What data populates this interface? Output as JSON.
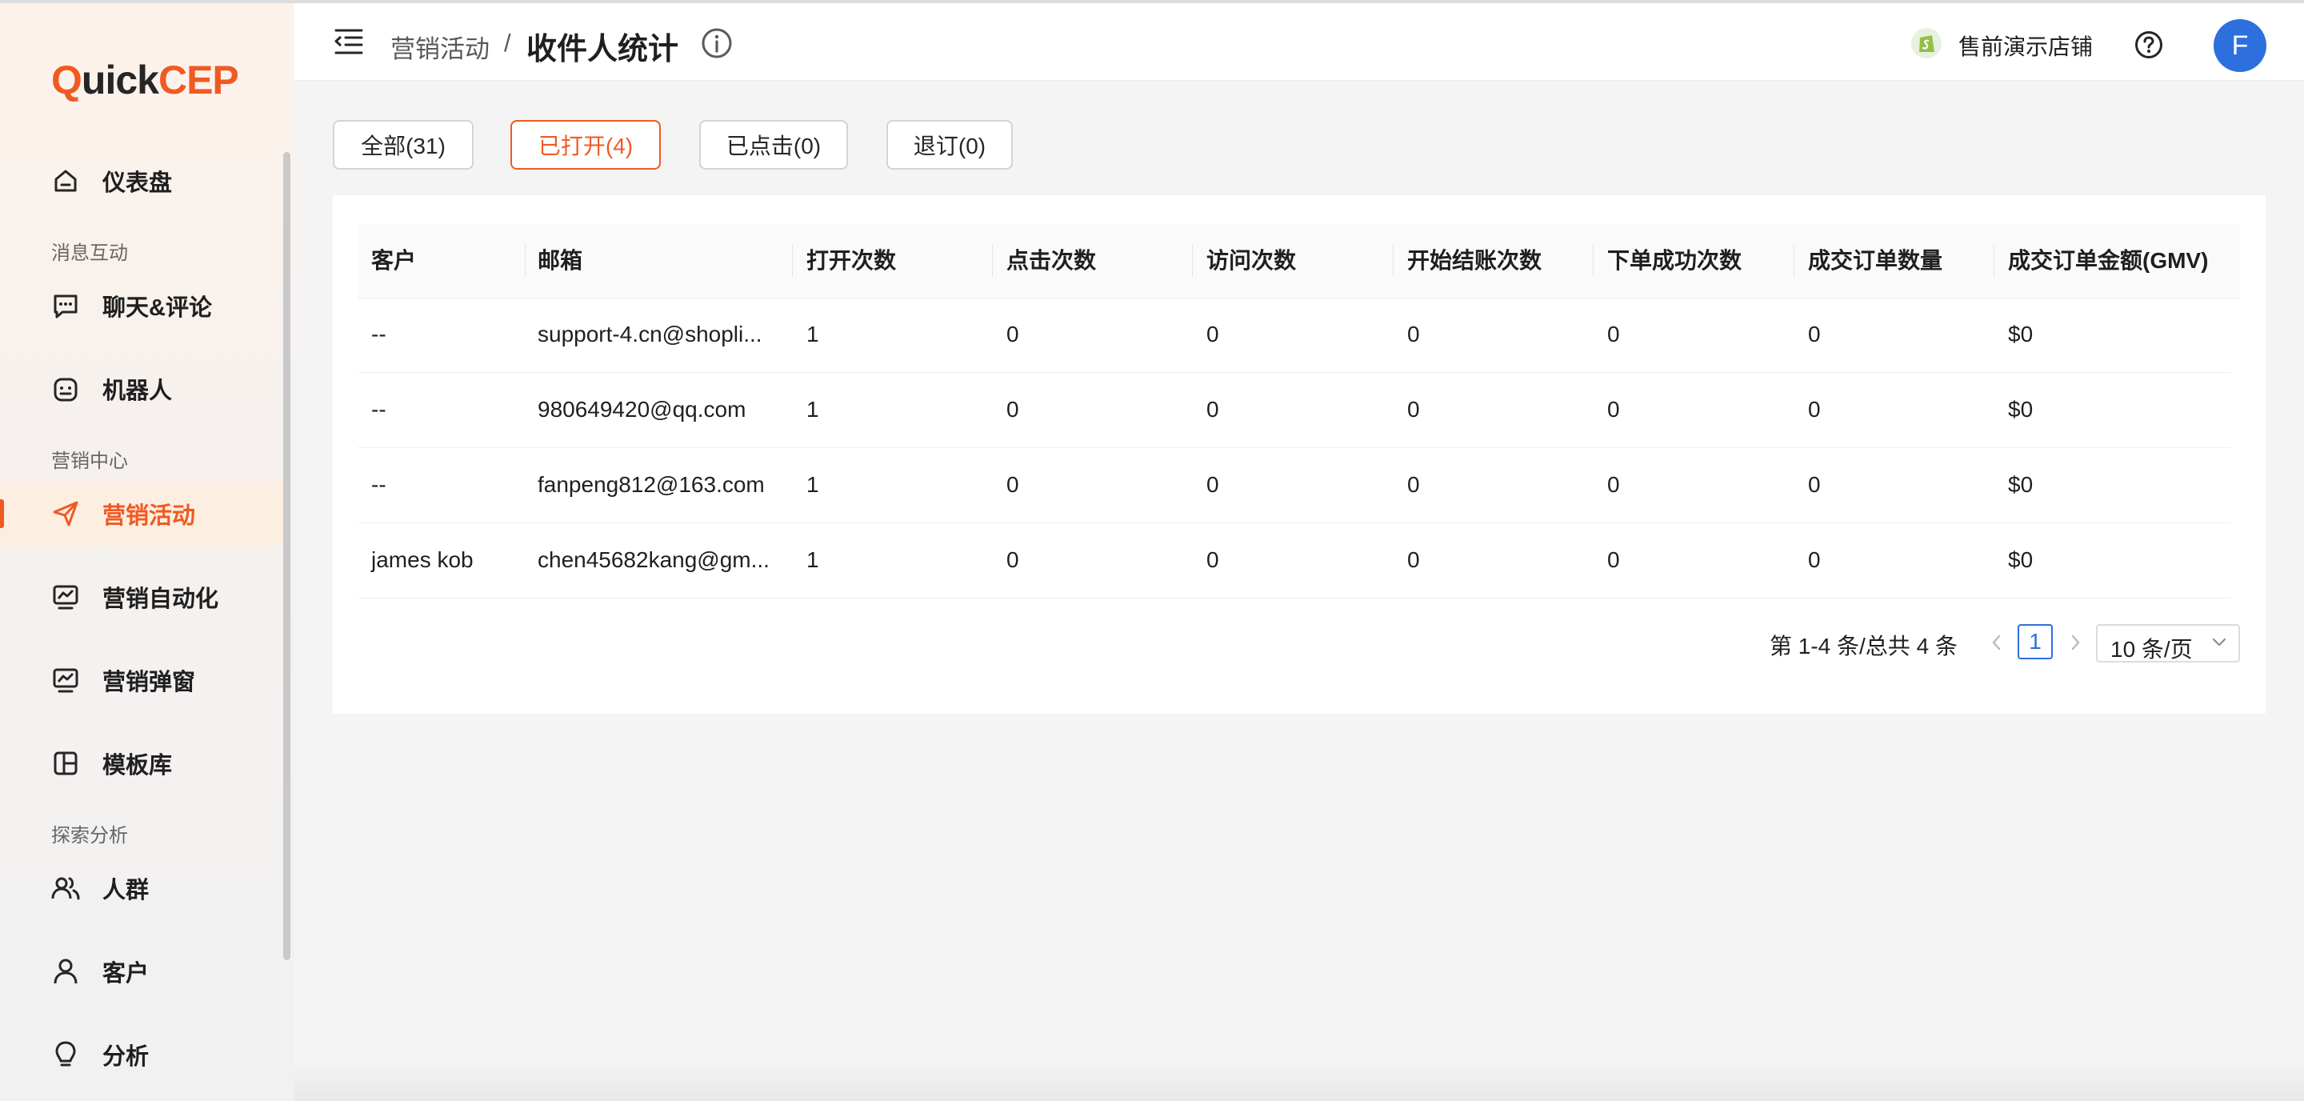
{
  "logo": {
    "part1": "Q",
    "part2": "uick",
    "part3": "CEP"
  },
  "sidebar": {
    "items": [
      {
        "label": "仪表盘",
        "icon": "home-icon"
      },
      {
        "label": "聊天&评论",
        "icon": "chat-icon"
      },
      {
        "label": "机器人",
        "icon": "robot-icon"
      },
      {
        "label": "营销活动",
        "icon": "send-icon",
        "active": true
      },
      {
        "label": "营销自动化",
        "icon": "monitor-chart-icon"
      },
      {
        "label": "营销弹窗",
        "icon": "monitor-chart-icon"
      },
      {
        "label": "模板库",
        "icon": "template-icon"
      },
      {
        "label": "人群",
        "icon": "users-icon"
      },
      {
        "label": "客户",
        "icon": "user-icon"
      },
      {
        "label": "分析",
        "icon": "bulb-icon"
      }
    ],
    "sections": [
      "消息互动",
      "营销中心",
      "探索分析"
    ]
  },
  "header": {
    "breadcrumb_parent": "营销活动",
    "breadcrumb_sep": "/",
    "title": "收件人统计",
    "store_name": "售前演示店铺",
    "avatar_letter": "F"
  },
  "filters": [
    {
      "label": "全部(31)",
      "active": false
    },
    {
      "label": "已打开(4)",
      "active": true
    },
    {
      "label": "已点击(0)",
      "active": false
    },
    {
      "label": "退订(0)",
      "active": false
    }
  ],
  "table": {
    "columns": [
      "客户",
      "邮箱",
      "打开次数",
      "点击次数",
      "访问次数",
      "开始结账次数",
      "下单成功次数",
      "成交订单数量",
      "成交订单金额(GMV)"
    ],
    "rows": [
      [
        "--",
        "support-4.cn@shopli...",
        "1",
        "0",
        "0",
        "0",
        "0",
        "0",
        "$0"
      ],
      [
        "--",
        "980649420@qq.com",
        "1",
        "0",
        "0",
        "0",
        "0",
        "0",
        "$0"
      ],
      [
        "--",
        "fanpeng812@163.com",
        "1",
        "0",
        "0",
        "0",
        "0",
        "0",
        "$0"
      ],
      [
        "james kob",
        "chen45682kang@gm...",
        "1",
        "0",
        "0",
        "0",
        "0",
        "0",
        "$0"
      ]
    ]
  },
  "pagination": {
    "total_text": "第 1-4 条/总共 4 条",
    "current_page": "1",
    "page_size": "10 条/页"
  },
  "colors": {
    "accent": "#f05a22",
    "primary": "#2d6fdc"
  }
}
